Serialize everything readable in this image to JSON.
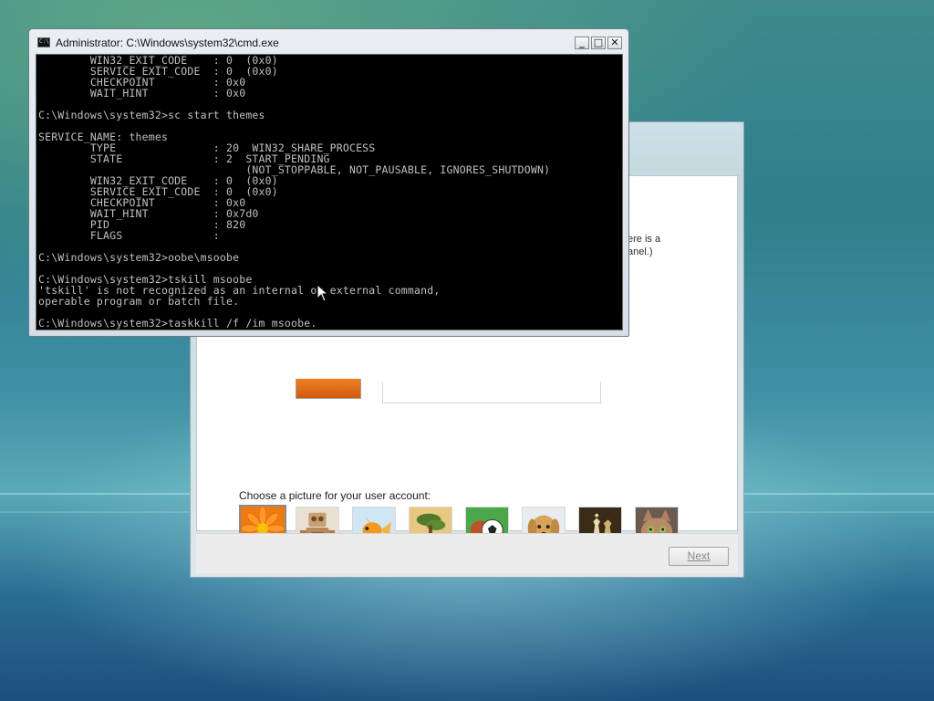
{
  "cmd_window": {
    "title": "Administrator: C:\\Windows\\system32\\cmd.exe",
    "icon_text": "C:\\",
    "minimize": "_",
    "maximize": "□",
    "close": "✕",
    "lines": [
      "        WIN32_EXIT_CODE    : 0  (0x0)",
      "        SERVICE_EXIT_CODE  : 0  (0x0)",
      "        CHECKPOINT         : 0x0",
      "        WAIT_HINT          : 0x0",
      "",
      "C:\\Windows\\system32>sc start themes",
      "",
      "SERVICE_NAME: themes",
      "        TYPE               : 20  WIN32_SHARE_PROCESS",
      "        STATE              : 2  START_PENDING",
      "                                (NOT_STOPPABLE, NOT_PAUSABLE, IGNORES_SHUTDOWN)",
      "        WIN32_EXIT_CODE    : 0  (0x0)",
      "        SERVICE_EXIT_CODE  : 0  (0x0)",
      "        CHECKPOINT         : 0x0",
      "        WAIT_HINT          : 0x7d0",
      "        PID                : 820",
      "        FLAGS              :",
      "",
      "C:\\Windows\\system32>oobe\\msoobe",
      "",
      "C:\\Windows\\system32>tskill msoobe",
      "'tskill' is not recognized as an internal or external command,",
      "operable program or batch file.",
      "",
      "C:\\Windows\\system32>taskkill /f /im msoobe."
    ]
  },
  "oobe": {
    "partial_text_1": "ere is a",
    "partial_text_2": "anel.)",
    "choose_picture_label": "Choose a picture for your user account:",
    "next_button": "Next",
    "pictures": [
      "flower-icon",
      "robot-icon",
      "goldfish-icon",
      "bonsai-icon",
      "soccer-ball-icon",
      "puppy-icon",
      "chess-icon",
      "kitten-icon"
    ],
    "selected_picture": "flower-icon"
  },
  "colors": {
    "console_bg": "#000000",
    "console_text": "#c0c0c0"
  }
}
